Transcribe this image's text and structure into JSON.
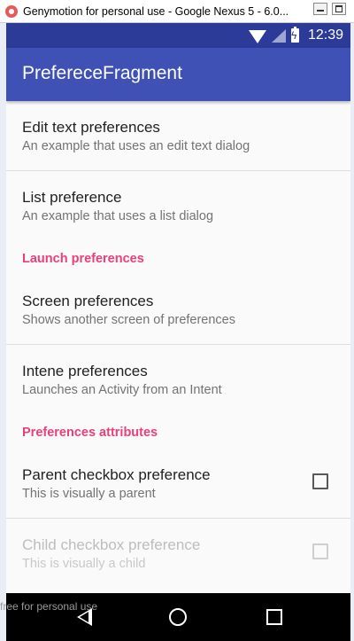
{
  "window": {
    "title": "Genymotion for personal use - Google Nexus 5 - 6.0...",
    "watermark": "free for personal use"
  },
  "status_bar": {
    "time": "12:39",
    "icons": [
      "wifi-icon",
      "signal-icon",
      "battery-charging-icon"
    ]
  },
  "app_bar": {
    "title": "PrefereceFragment",
    "color": "#3f51b5"
  },
  "preferences": {
    "edit_text": {
      "title": "Edit text preferences",
      "summary": "An example that uses an edit text dialog"
    },
    "list": {
      "title": "List preference",
      "summary": "An example that uses a list dialog"
    },
    "category_launch": "Launch preferences",
    "screen": {
      "title": "Screen preferences",
      "summary": "Shows another screen of preferences"
    },
    "intent": {
      "title": "Intene preferences",
      "summary": "Launches an Activity from an Intent"
    },
    "category_attributes": "Preferences attributes",
    "parent_checkbox": {
      "title": "Parent checkbox preference",
      "summary": "This is visually a parent",
      "checked": false
    },
    "child_checkbox": {
      "title": "Child checkbox preference",
      "summary": "This is visually a child",
      "checked": false,
      "enabled": false
    }
  },
  "colors": {
    "accent": "#e8407a",
    "status_bar": "#2c3b97"
  },
  "nav_bar": {
    "buttons": [
      "back-icon",
      "home-icon",
      "recents-icon"
    ]
  }
}
